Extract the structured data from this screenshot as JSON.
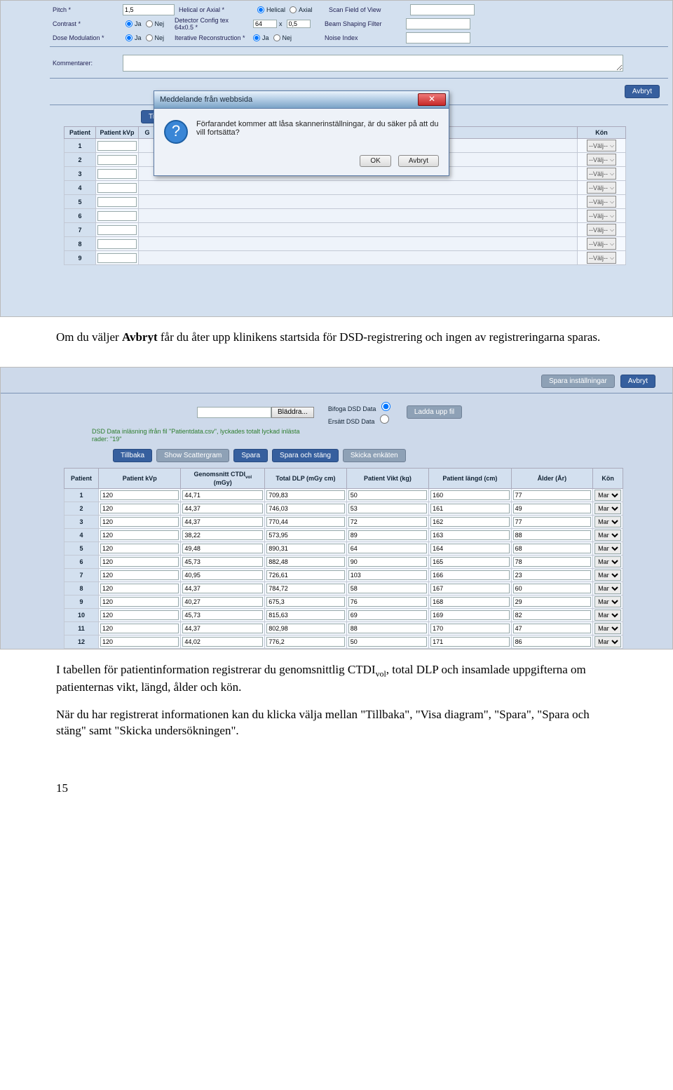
{
  "sc1": {
    "rows": [
      {
        "label": "Pitch *",
        "value": "1,5",
        "label2": "Helical or Axial *",
        "opts": [
          "Helical",
          "Axial"
        ],
        "sel": 0,
        "label3": "Scan Field of View",
        "val3": ""
      },
      {
        "label": "Contrast *",
        "opts": [
          "Ja",
          "Nej"
        ],
        "sel": 0,
        "label2": "Detector Config tex 64x0.5 *",
        "v2a": "64",
        "v2b": "0,5",
        "label3": "Beam Shaping Filter",
        "val3": ""
      },
      {
        "label": "Dose Modulation *",
        "opts": [
          "Ja",
          "Nej"
        ],
        "sel": 0,
        "label2": "Iterative Reconstruction *",
        "opts2": [
          "Ja",
          "Nej"
        ],
        "sel2": 0,
        "label3": "Noise Index",
        "val3": ""
      }
    ],
    "kommentarer_lbl": "Kommentarer:",
    "avbryt": "Avbryt",
    "tillbaka": "Tillba",
    "headers": [
      "Patient",
      "Patient kVp",
      "G",
      "",
      "",
      "",
      "",
      "",
      "Kön"
    ],
    "valj": "--Välj--",
    "rowcount": 9,
    "modal": {
      "title": "Meddelande från webbsida",
      "text": "Förfarandet kommer att låsa skannerinställningar, är du säker på att du vill fortsätta?",
      "ok": "OK",
      "cancel": "Avbryt"
    }
  },
  "para1": "Om du väljer Avbryt får du åter upp klinikens startsida för DSD-registrering och ingen av registreringarna sparas.",
  "sc2": {
    "spara_inst": "Spara inställningar",
    "avbryt": "Avbryt",
    "bladdra": "Bläddra...",
    "bifoga": "Bifoga DSD Data",
    "ersatt": "Ersätt DSD Data",
    "ladda": "Ladda upp fil",
    "green": "DSD Data inläsning ifrån fil \"Patientdata.csv\", lyckades totalt lyckad inlästa rader: \"19\"",
    "buttons": [
      "Tillbaka",
      "Show Scattergram",
      "Spara",
      "Spara och stäng",
      "Skicka enkäten"
    ],
    "headers": [
      "Patient",
      "Patient kVp",
      "Genomsnitt CTDIvol (mGy)",
      "Total DLP (mGy cm)",
      "Patient Vikt (kg)",
      "Patient längd (cm)",
      "Ålder (År)",
      "Kön"
    ],
    "rows": [
      {
        "n": 1,
        "kvp": "120",
        "ctdi": "44,71",
        "dlp": "709,83",
        "vikt": "50",
        "langd": "160",
        "alder": "77",
        "kon": "Man"
      },
      {
        "n": 2,
        "kvp": "120",
        "ctdi": "44,37",
        "dlp": "746,03",
        "vikt": "53",
        "langd": "161",
        "alder": "49",
        "kon": "Man"
      },
      {
        "n": 3,
        "kvp": "120",
        "ctdi": "44,37",
        "dlp": "770,44",
        "vikt": "72",
        "langd": "162",
        "alder": "77",
        "kon": "Man"
      },
      {
        "n": 4,
        "kvp": "120",
        "ctdi": "38,22",
        "dlp": "573,95",
        "vikt": "89",
        "langd": "163",
        "alder": "88",
        "kon": "Man"
      },
      {
        "n": 5,
        "kvp": "120",
        "ctdi": "49,48",
        "dlp": "890,31",
        "vikt": "64",
        "langd": "164",
        "alder": "68",
        "kon": "Man"
      },
      {
        "n": 6,
        "kvp": "120",
        "ctdi": "45,73",
        "dlp": "882,48",
        "vikt": "90",
        "langd": "165",
        "alder": "78",
        "kon": "Man"
      },
      {
        "n": 7,
        "kvp": "120",
        "ctdi": "40,95",
        "dlp": "726,61",
        "vikt": "103",
        "langd": "166",
        "alder": "23",
        "kon": "Man"
      },
      {
        "n": 8,
        "kvp": "120",
        "ctdi": "44,37",
        "dlp": "784,72",
        "vikt": "58",
        "langd": "167",
        "alder": "60",
        "kon": "Man"
      },
      {
        "n": 9,
        "kvp": "120",
        "ctdi": "40,27",
        "dlp": "675,3",
        "vikt": "76",
        "langd": "168",
        "alder": "29",
        "kon": "Man"
      },
      {
        "n": 10,
        "kvp": "120",
        "ctdi": "45,73",
        "dlp": "815,63",
        "vikt": "69",
        "langd": "169",
        "alder": "82",
        "kon": "Man"
      },
      {
        "n": 11,
        "kvp": "120",
        "ctdi": "44,37",
        "dlp": "802,98",
        "vikt": "88",
        "langd": "170",
        "alder": "47",
        "kon": "Man"
      },
      {
        "n": 12,
        "kvp": "120",
        "ctdi": "44,02",
        "dlp": "776,2",
        "vikt": "50",
        "langd": "171",
        "alder": "86",
        "kon": "Man"
      }
    ]
  },
  "para2_pre": "I tabellen för patientinformation registrerar du genomsnittlig CTDI",
  "para2_sub": "vol",
  "para2_post": ", total DLP och insamlade uppgifterna om patienternas vikt, längd, ålder och kön.",
  "para3": "När du har registrerat informationen kan du klicka välja mellan \"Tillbaka\", \"Visa diagram\", \"Spara\", \"Spara och stäng\" samt \"Skicka undersökningen\".",
  "pagenum": "15"
}
